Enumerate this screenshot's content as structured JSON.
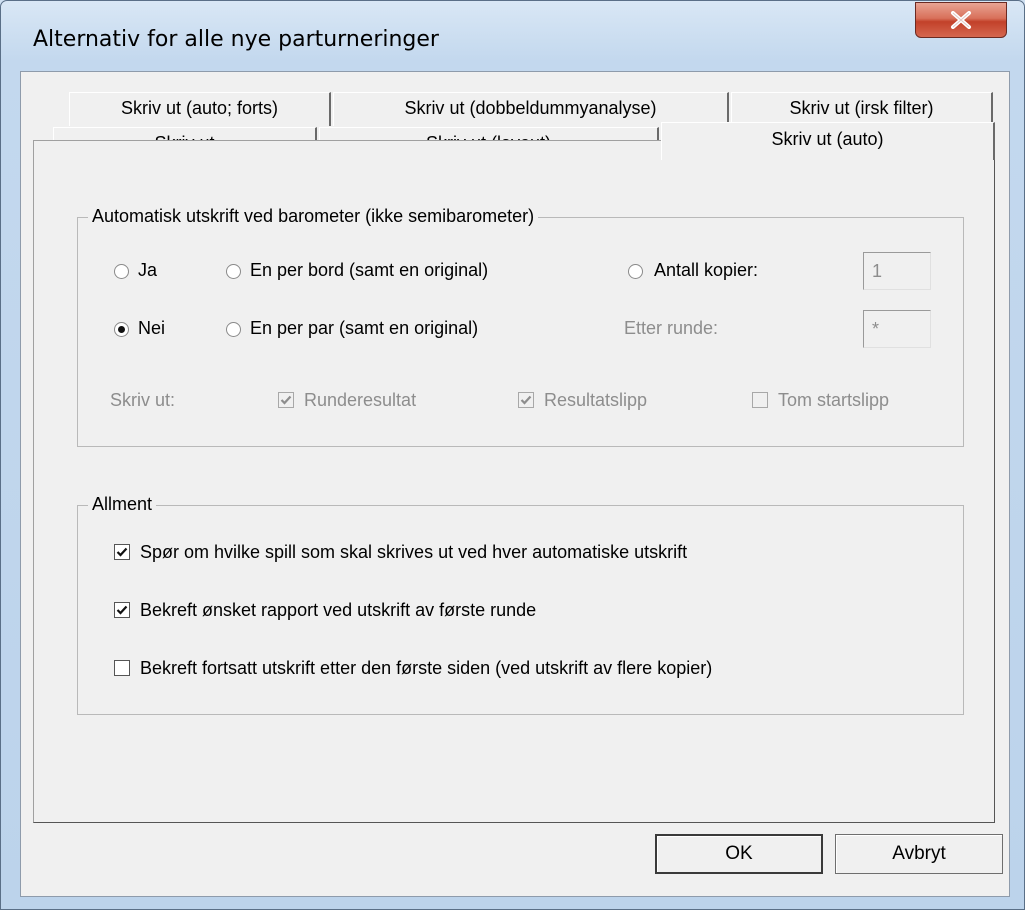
{
  "window": {
    "title": "Alternativ for alle nye parturneringer"
  },
  "tabs_back": [
    "Skriv ut (auto; forts)",
    "Skriv ut (dobbeldummyanalyse)",
    "Skriv ut (irsk filter)"
  ],
  "tabs_front": [
    "Skriv ut",
    "Skriv ut (layout)",
    "Skriv ut (auto)"
  ],
  "auto_group": {
    "legend": "Automatisk utskrift ved barometer (ikke semibarometer)",
    "radio_ja": "Ja",
    "radio_nei": "Nei",
    "radio_en_per_bord": "En per bord (samt en original)",
    "radio_en_per_par": "En per par (samt en original)",
    "radio_antall_kopier": "Antall kopier:",
    "antall_kopier_value": "1",
    "etter_runde_label": "Etter runde:",
    "etter_runde_value": "*",
    "skriv_ut_label": "Skriv ut:",
    "cb_runderesultat": "Runderesultat",
    "cb_resultatslipp": "Resultatslipp",
    "cb_tom_startslipp": "Tom startslipp",
    "selected_radio": "Nei"
  },
  "general_group": {
    "legend": "Allment",
    "cb1": "Spør om hvilke spill som skal skrives ut ved hver automatiske utskrift",
    "cb1_checked": true,
    "cb2": "Bekreft ønsket rapport ved utskrift av første runde",
    "cb2_checked": true,
    "cb3": "Bekreft fortsatt utskrift etter den første siden (ved utskrift av flere kopier)",
    "cb3_checked": false
  },
  "buttons": {
    "ok": "OK",
    "cancel": "Avbryt"
  },
  "icons": {
    "close": "close-x-icon",
    "check": "checkmark-icon"
  }
}
